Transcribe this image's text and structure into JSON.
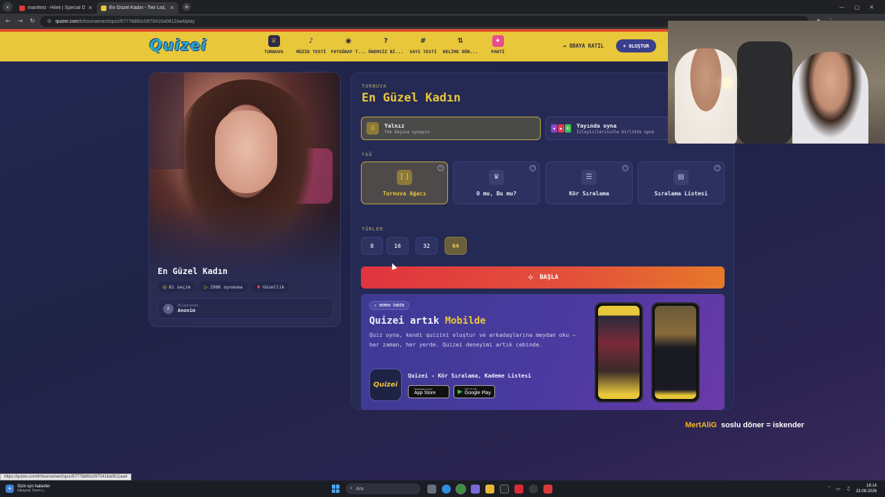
{
  "browser": {
    "tabs": [
      {
        "title": "manifest - Hileli | Special Dance",
        "active": false,
        "favicon_color": "#e53935"
      },
      {
        "title": "En Güzel Kadın - Tier List, Kör S",
        "active": true,
        "favicon_color": "#e8c73a"
      }
    ],
    "url_domain": "quizei.com",
    "url_path": "/tr/tournament/quiz/67778d60c0970416a0812aa4/play"
  },
  "site": {
    "logo": "Quizei",
    "nav": [
      {
        "label": "TURNUVA",
        "icon": "trophy-icon",
        "glyph": "♕",
        "active": true
      },
      {
        "label": "MÜZİK TESTİ",
        "icon": "music-icon",
        "glyph": "♪",
        "active": false
      },
      {
        "label": "FOTOĞRAF T...",
        "icon": "camera-icon",
        "glyph": "◉",
        "active": false
      },
      {
        "label": "ÖNEMSİZ Bİ...",
        "icon": "question-icon",
        "glyph": "?",
        "active": false
      },
      {
        "label": "SAYI TESTİ",
        "icon": "hash-icon",
        "glyph": "#",
        "active": false
      },
      {
        "label": "KELİME DÖN...",
        "icon": "sort-icon",
        "glyph": "⇅",
        "active": false
      },
      {
        "label": "PARTİ",
        "icon": "party-icon",
        "glyph": "✦",
        "active": false
      }
    ],
    "join_room": "ODAYA KATIL",
    "create": "OLUŞTUR"
  },
  "quiz": {
    "title": "En Güzel Kadın",
    "stats": [
      {
        "icon": "choices-icon",
        "text": "81 seçim"
      },
      {
        "icon": "play-icon",
        "text": "298K oynanma"
      },
      {
        "icon": "heart-icon",
        "text": "Güzellik"
      }
    ],
    "creator_label": "Oluşturan",
    "creator_name": "Anonim",
    "creator_initial": "A"
  },
  "settings": {
    "section": "TURNUVA",
    "title": "En Güzel Kadın",
    "modes": [
      {
        "name": "Yalnız",
        "desc": "Tek başına oynayın"
      },
      {
        "name": "Yayında oyna",
        "desc": "İzleyicilerinizle birlikte oyna"
      }
    ],
    "format_label": "YAĞ",
    "formats": [
      {
        "name": "Turnuva Ağacı",
        "glyph": "[ ]",
        "active": true
      },
      {
        "name": "O mu, Bu mu?",
        "glyph": "♛",
        "active": false
      },
      {
        "name": "Kör Sıralama",
        "glyph": "☰",
        "active": false
      },
      {
        "name": "Sıralama Listesi",
        "glyph": "▤",
        "active": false
      }
    ],
    "help": "?",
    "sizes_label": "TÜRLER",
    "sizes": [
      "8",
      "16",
      "32",
      "64"
    ],
    "selected_size": "64",
    "start": "BAŞLA"
  },
  "promo": {
    "badge": "HEMEN İNDİR",
    "title_a": "Quizei artık ",
    "title_b": "Mobilde",
    "desc": "Quiz oyna, kendi quizini oluştur ve arkadaşlarına meydan oku — her zaman, her yerde. Quizei deneyimi artık cebinde.",
    "app_name": "Quizei - Kör Sıralama, Kademe Listesi",
    "app_icon_text": "Quizei",
    "appstore_small": "Download on the",
    "appstore_big": "App Store",
    "googleplay_small": "GET IT ON",
    "googleplay_big": "Google Play"
  },
  "chat": {
    "user": "MertAliG",
    "message": "soslu döner = iskender"
  },
  "status_url": "https://quizei.com/tr/tournament/quiz/67778d60c0970416a0812aa4",
  "taskbar": {
    "news_title": "Sizin için haberler",
    "news_sub": "Ukrayna: Tarım v...",
    "search": "Ara",
    "time": "18:14",
    "date": "23.08.2026"
  }
}
